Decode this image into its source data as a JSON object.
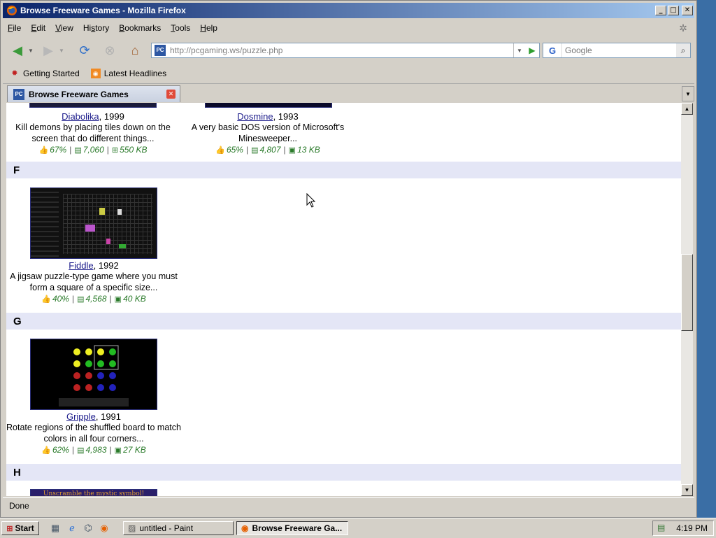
{
  "window": {
    "title": "Browse Freeware Games - Mozilla Firefox"
  },
  "menu": [
    {
      "label": "File",
      "key": "F"
    },
    {
      "label": "Edit",
      "key": "E"
    },
    {
      "label": "View",
      "key": "V"
    },
    {
      "label": "History",
      "key": "s"
    },
    {
      "label": "Bookmarks",
      "key": "B"
    },
    {
      "label": "Tools",
      "key": "T"
    },
    {
      "label": "Help",
      "key": "H"
    }
  ],
  "nav": {
    "url": "http://pcgaming.ws/puzzle.php",
    "search_engine": "G",
    "search_placeholder": "Google"
  },
  "bookmarks": [
    {
      "label": "Getting Started",
      "icon": "bug-icon"
    },
    {
      "label": "Latest Headlines",
      "icon": "rss-icon"
    }
  ],
  "tab": {
    "label": "Browse Freeware Games"
  },
  "games": [
    {
      "name": "Diabolika",
      "year": ", 1999",
      "desc": "Kill demons by placing tiles down on the screen that do different things...",
      "rating": "67%",
      "downloads": "7,060",
      "size": "550 KB",
      "platform": "windows-icon"
    },
    {
      "name": "Dosmine",
      "year": ", 1993",
      "desc": "A very basic DOS version of Microsoft's Minesweeper...",
      "rating": "65%",
      "downloads": "4,807",
      "size": "13 KB",
      "platform": "dos-icon"
    },
    {
      "name": "Fiddle",
      "year": ", 1992",
      "desc": "A jigsaw puzzle-type game where you must form a square of a specific size...",
      "rating": "40%",
      "downloads": "4,568",
      "size": "40 KB",
      "platform": "dos-icon"
    },
    {
      "name": "Gripple",
      "year": ", 1991",
      "desc": "Rotate regions of the shuffled board to match colors in all four corners...",
      "rating": "62%",
      "downloads": "4,983",
      "size": "27 KB",
      "platform": "dos-icon"
    }
  ],
  "sections": [
    "F",
    "G",
    "H"
  ],
  "h_banner": "Unscramble the mystic symbol!",
  "status": "Done",
  "taskbar": {
    "start": "Start",
    "tasks": [
      "untitled - Paint",
      "Browse Freeware Ga..."
    ],
    "clock": "4:19 PM"
  }
}
